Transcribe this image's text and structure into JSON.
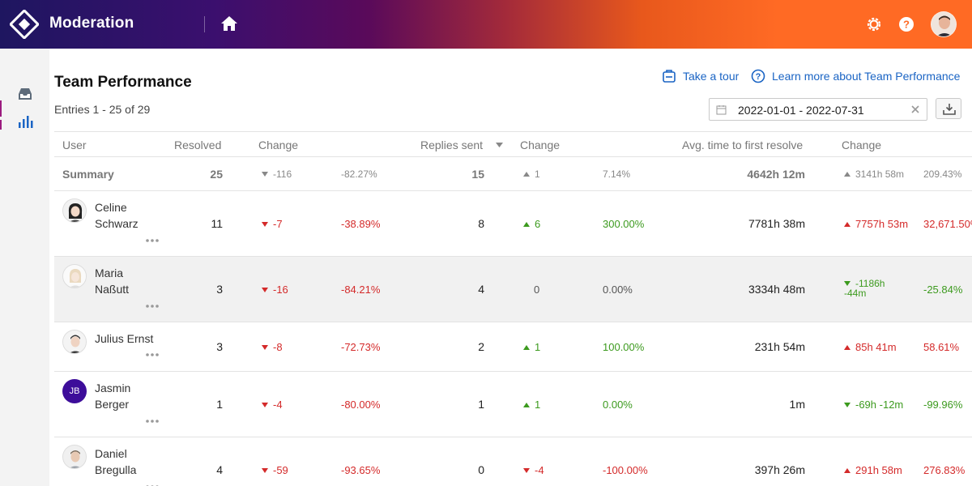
{
  "app": {
    "title": "Moderation"
  },
  "header": {
    "icons": [
      "home-icon",
      "settings-icon",
      "help-icon",
      "user-avatar"
    ]
  },
  "sidebar": {
    "items": [
      {
        "icon": "inbox-icon"
      },
      {
        "icon": "bar-chart-icon"
      }
    ]
  },
  "page": {
    "title": "Team Performance",
    "entries": "Entries 1 - 25 of 29",
    "tour_link": "Take a tour",
    "learn_link": "Learn more about Team Performance",
    "date_range": "2022-01-01 - 2022-07-31"
  },
  "table": {
    "columns": {
      "user": "User",
      "resolved": "Resolved",
      "change1": "Change",
      "replies": "Replies sent",
      "change2": "Change",
      "avg_time": "Avg. time to first resolve",
      "change3": "Change"
    },
    "summary": {
      "label": "Summary",
      "resolved": "25",
      "resolved_change": "-116",
      "resolved_pct": "-82.27%",
      "replies": "15",
      "replies_change": "1",
      "replies_pct": "7.14%",
      "avg_time": "4642h 12m",
      "avg_change": "3141h 58m",
      "avg_pct": "209.43%"
    },
    "rows": [
      {
        "name_line1": "Celine",
        "name_line2": "Schwarz",
        "resolved": "11",
        "resolved_change": "-7",
        "resolved_pct": "-38.89%",
        "replies": "8",
        "replies_change": "6",
        "replies_pct": "300.00%",
        "avg_time": "7781h 38m",
        "avg_change": "7757h 53m",
        "avg_pct": "32,671.50%"
      },
      {
        "name_line1": "Maria",
        "name_line2": "Naßutt",
        "resolved": "3",
        "resolved_change": "-16",
        "resolved_pct": "-84.21%",
        "replies": "4",
        "replies_change": "0",
        "replies_pct": "0.00%",
        "avg_time": "3334h 48m",
        "avg_change_line1": "-1186h",
        "avg_change_line2": "-44m",
        "avg_pct": "-25.84%"
      },
      {
        "name_line1": "Julius Ernst",
        "resolved": "3",
        "resolved_change": "-8",
        "resolved_pct": "-72.73%",
        "replies": "2",
        "replies_change": "1",
        "replies_pct": "100.00%",
        "avg_time": "231h 54m",
        "avg_change": "85h 41m",
        "avg_pct": "58.61%"
      },
      {
        "initials": "JB",
        "name_line1": "Jasmin",
        "name_line2": "Berger",
        "resolved": "1",
        "resolved_change": "-4",
        "resolved_pct": "-80.00%",
        "replies": "1",
        "replies_change": "1",
        "replies_pct": "0.00%",
        "avg_time": "1m",
        "avg_change": "-69h -12m",
        "avg_pct": "-99.96%"
      },
      {
        "name_line1": "Daniel",
        "name_line2": "Bregulla",
        "resolved": "4",
        "resolved_change": "-59",
        "resolved_pct": "-93.65%",
        "replies": "0",
        "replies_change": "-4",
        "replies_pct": "-100.00%",
        "avg_time": "397h 26m",
        "avg_change": "291h 58m",
        "avg_pct": "276.83%"
      }
    ]
  },
  "colors": {
    "accent_blue": "#1a64c4",
    "negative": "#d42a2a",
    "positive": "#3c9a1e",
    "initials_bg": "#3d0d9a"
  }
}
